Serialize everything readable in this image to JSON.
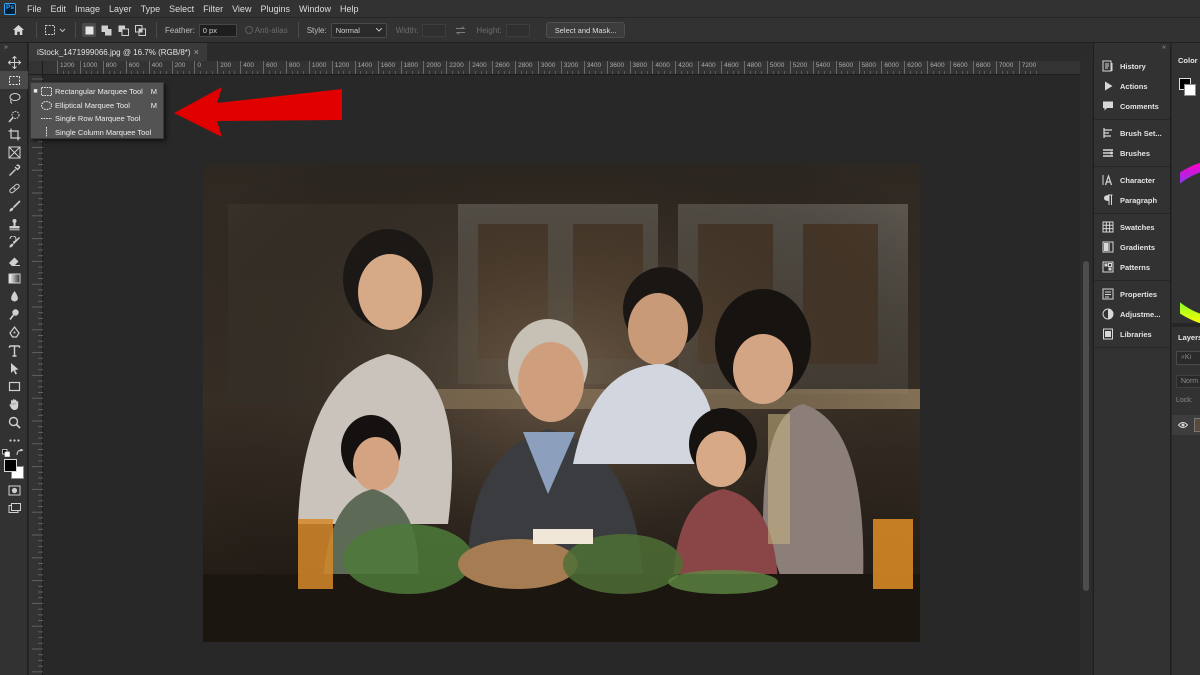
{
  "app": {
    "logo_text": "Ps"
  },
  "menu": [
    "File",
    "Edit",
    "Image",
    "Layer",
    "Type",
    "Select",
    "Filter",
    "View",
    "Plugins",
    "Window",
    "Help"
  ],
  "options_bar": {
    "feather_label": "Feather:",
    "feather_value": "0 px",
    "antialias_label": "Anti-alias",
    "style_label": "Style:",
    "style_value": "Normal",
    "width_label": "Width:",
    "height_label": "Height:",
    "select_mask_label": "Select and Mask..."
  },
  "document": {
    "tab_title": "iStock_1471999066.jpg @ 16.7% (RGB/8*)",
    "close_glyph": "×"
  },
  "ruler": {
    "labels": [
      "1200",
      "1000",
      "800",
      "600",
      "400",
      "200",
      "0",
      "200",
      "400",
      "600",
      "800",
      "1000",
      "1200",
      "1400",
      "1600",
      "1800",
      "2000",
      "2200",
      "2400",
      "2600",
      "2800",
      "3000",
      "3200",
      "3400",
      "3600",
      "3800",
      "4000",
      "4200",
      "4400",
      "4600",
      "4800",
      "5000",
      "5200",
      "5400",
      "5600",
      "5800",
      "6000",
      "6200",
      "6400",
      "6600",
      "6800",
      "7000",
      "7200"
    ]
  },
  "flyout": {
    "items": [
      {
        "label": "Rectangular Marquee Tool",
        "shortcut": "M",
        "active": true
      },
      {
        "label": "Elliptical Marquee Tool",
        "shortcut": "M",
        "active": false
      },
      {
        "label": "Single Row Marquee Tool",
        "shortcut": "",
        "active": false
      },
      {
        "label": "Single Column Marquee Tool",
        "shortcut": "",
        "active": false
      }
    ]
  },
  "annotation": {
    "arrow_color": "#e00000"
  },
  "panels": {
    "groups": [
      [
        {
          "label": "History",
          "icon": "history-icon"
        },
        {
          "label": "Actions",
          "icon": "play-icon"
        },
        {
          "label": "Comments",
          "icon": "comment-icon"
        }
      ],
      [
        {
          "label": "Brush Set...",
          "icon": "brush-settings-icon"
        },
        {
          "label": "Brushes",
          "icon": "brushes-icon"
        }
      ],
      [
        {
          "label": "Character",
          "icon": "character-icon"
        },
        {
          "label": "Paragraph",
          "icon": "paragraph-icon"
        }
      ],
      [
        {
          "label": "Swatches",
          "icon": "swatches-icon"
        },
        {
          "label": "Gradients",
          "icon": "gradients-icon"
        },
        {
          "label": "Patterns",
          "icon": "patterns-icon"
        }
      ],
      [
        {
          "label": "Properties",
          "icon": "properties-icon"
        },
        {
          "label": "Adjustme...",
          "icon": "adjustments-icon"
        },
        {
          "label": "Libraries",
          "icon": "libraries-icon"
        }
      ]
    ]
  },
  "far_right": {
    "color_tab": "Color",
    "layers_tab": "Layers",
    "kind_placeholder": "Ki",
    "blend_mode": "Norm",
    "lock_label": "Lock:"
  },
  "colors": {
    "accent": "#31a8ff",
    "foreground": "#000000",
    "background": "#ffffff"
  }
}
